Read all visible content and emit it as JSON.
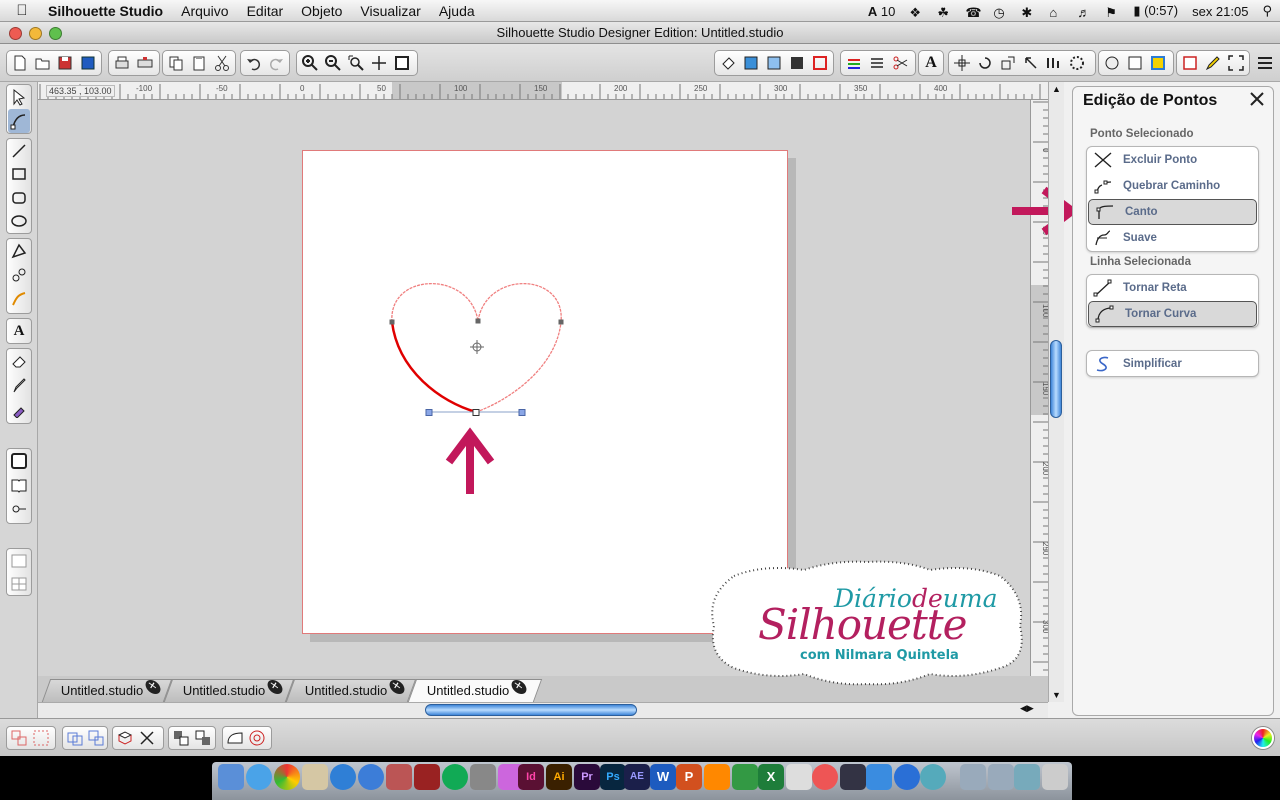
{
  "menubar": {
    "app_name": "Silhouette Studio",
    "items": [
      "Arquivo",
      "Editar",
      "Objeto",
      "Visualizar",
      "Ajuda"
    ],
    "status": {
      "adobe_count": "10",
      "battery": "(0:57)",
      "clock": "sex 21:05"
    }
  },
  "window": {
    "title": "Silhouette Studio Designer Edition: Untitled.studio"
  },
  "ruler": {
    "coords": "463.35 , 103.00",
    "h_ticks": [
      "-100",
      "-50",
      "0",
      "50",
      "100",
      "150",
      "200",
      "250",
      "300",
      "350",
      "400"
    ],
    "v_ticks": [
      "0",
      "50",
      "100",
      "150",
      "200",
      "250",
      "300"
    ]
  },
  "tabs": [
    {
      "label": "Untitled.studio",
      "active": false
    },
    {
      "label": "Untitled.studio",
      "active": false
    },
    {
      "label": "Untitled.studio",
      "active": false
    },
    {
      "label": "Untitled.studio",
      "active": true
    }
  ],
  "panel": {
    "title": "Edição de Pontos",
    "point_section": "Ponto Selecionado",
    "point_actions": [
      {
        "label": "Excluir Ponto",
        "icon": "delete-point-icon",
        "selected": false
      },
      {
        "label": "Quebrar Caminho",
        "icon": "break-path-icon",
        "selected": false
      },
      {
        "label": "Canto",
        "icon": "corner-point-icon",
        "selected": true
      },
      {
        "label": "Suave",
        "icon": "smooth-point-icon",
        "selected": false
      }
    ],
    "line_section": "Linha Selecionada",
    "line_actions": [
      {
        "label": "Tornar Reta",
        "icon": "make-straight-icon",
        "selected": false
      },
      {
        "label": "Tornar Curva",
        "icon": "make-curve-icon",
        "selected": true
      }
    ],
    "simplify_label": "Simplificar"
  },
  "watermark": {
    "line1": "Diário",
    "line1b": "de",
    "line1c": "uma",
    "line2": "Silhouette",
    "line3": "com Nilmara Quintela"
  },
  "colors": {
    "accent_arrow": "#c2185b",
    "path_selected": "#e00000",
    "path_normal": "#f08080",
    "scroll_blue": "#3f86d8",
    "watermark_pink": "#b3205f",
    "watermark_teal": "#1f9aa5"
  }
}
